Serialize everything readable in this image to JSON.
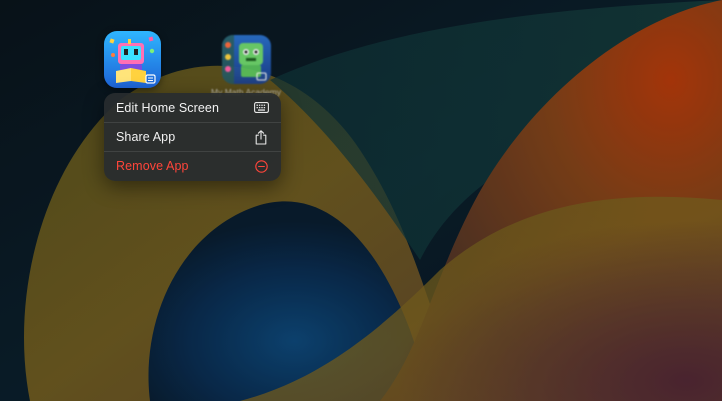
{
  "home_screen": {
    "apps": [
      {
        "name": "",
        "icon": "robot-reader-app-icon",
        "focused": true
      },
      {
        "name": "My Math Academy",
        "icon": "math-monster-app-icon",
        "focused": false
      }
    ]
  },
  "context_menu": {
    "items": [
      {
        "label": "Edit Home Screen",
        "icon": "keyboard-icon",
        "destructive": false
      },
      {
        "label": "Share App",
        "icon": "share-icon",
        "destructive": false
      },
      {
        "label": "Remove App",
        "icon": "minus-circle-icon",
        "destructive": true
      }
    ]
  },
  "colors": {
    "destructive": "#ff453a",
    "menu_background": "#282c2e",
    "wallpaper_orange": "#c2470f",
    "wallpaper_blue": "#0a3f6a"
  }
}
